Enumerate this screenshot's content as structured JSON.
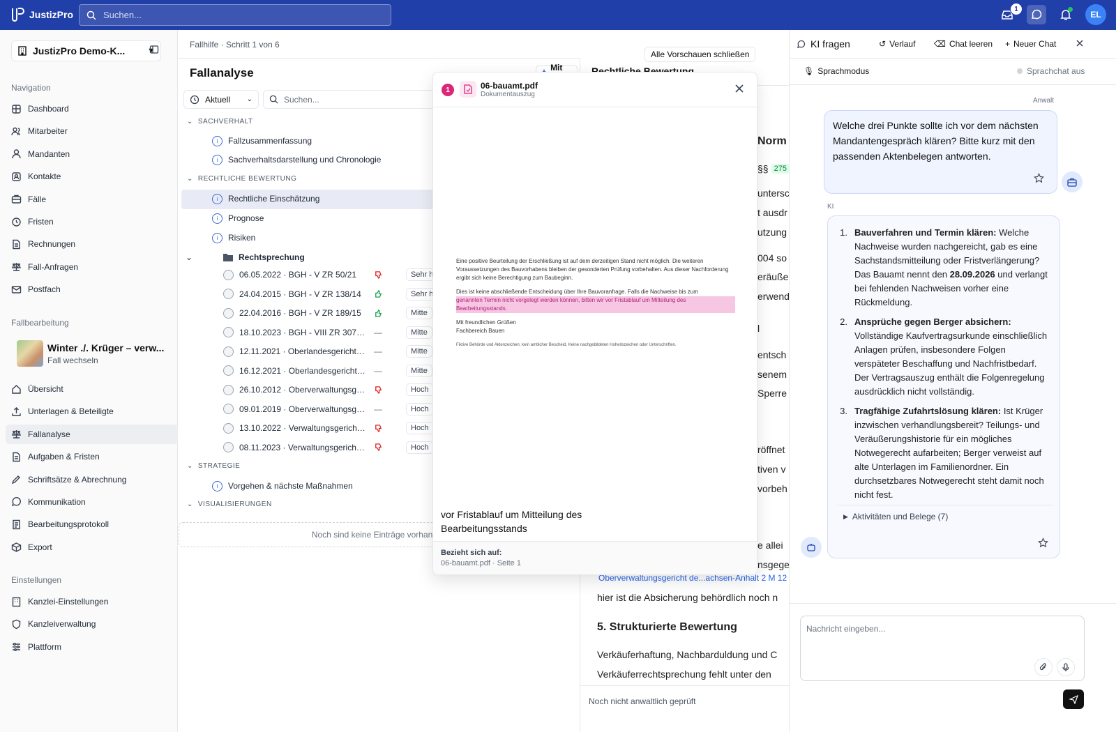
{
  "topbar": {
    "brand": "JustizPro",
    "search_placeholder": "Suchen...",
    "badge_count": "1",
    "avatar_initials": "EL"
  },
  "sidebar": {
    "org_name": "JustizPro Demo-K...",
    "nav_heading": "Navigation",
    "nav": [
      "Dashboard",
      "Mitarbeiter",
      "Mandanten",
      "Kontakte",
      "Fälle",
      "Fristen",
      "Rechnungen",
      "Fall-Anfragen",
      "Postfach"
    ],
    "case_heading": "Fallbearbeitung",
    "case_title": "Winter ./. Krüger – verw...",
    "case_switch": "Fall wechseln",
    "case_nav": [
      "Übersicht",
      "Unterlagen & Beteiligte",
      "Fallanalyse",
      "Aufgaben & Fristen",
      "Schriftsätze & Abrechnung",
      "Kommunikation",
      "Bearbeitungsprotokoll",
      "Export"
    ],
    "settings_heading": "Einstellungen",
    "settings": [
      "Kanzlei-Einstellungen",
      "Kanzleiverwaltung",
      "Plattform"
    ]
  },
  "main": {
    "breadcrumb": "Fallhilfe · Schritt 1 von 6",
    "title": "Fallanalyse",
    "ai_button": "Mit KI",
    "filter_label": "Aktuell",
    "search_placeholder": "Suchen...",
    "sections": {
      "sachverhalt": "SACHVERHALT",
      "rechtlich": "RECHTLICHE BEWERTUNG",
      "strategie": "STRATEGIE",
      "visual": "VISUALISIERUNGEN"
    },
    "sachverhalt_items": [
      "Fallzusammenfassung",
      "Sachverhaltsdarstellung und Chronologie"
    ],
    "rechtlich_items": [
      "Rechtliche Einschätzung",
      "Prognose",
      "Risiken"
    ],
    "folder": "Rechtsprechung",
    "cases": [
      {
        "label": "06.05.2022 · BGH - V ZR 50/21",
        "vote": "down",
        "tag": "Sehr hoch"
      },
      {
        "label": "24.04.2015 · BGH - V ZR 138/14",
        "vote": "up",
        "tag": "Sehr hoch"
      },
      {
        "label": "22.04.2016 · BGH - V ZR 189/15",
        "vote": "up",
        "tag": "Mitte"
      },
      {
        "label": "18.10.2023 · BGH - VIII ZR 307/20",
        "vote": "none",
        "tag": "Mitte"
      },
      {
        "label": "12.11.2021 · Oberlandesgericht Ka...",
        "vote": "none",
        "tag": "Mitte"
      },
      {
        "label": "16.12.2021 · Oberlandesgericht K...",
        "vote": "none",
        "tag": "Mitte"
      },
      {
        "label": "26.10.2012 · Oberverwaltungsger...",
        "vote": "down",
        "tag": "Hoch"
      },
      {
        "label": "09.01.2019 · Oberverwaltungsger...",
        "vote": "none",
        "tag": "Hoch"
      },
      {
        "label": "13.10.2022 · Verwaltungsgericht ...",
        "vote": "down",
        "tag": "Hoch"
      },
      {
        "label": "08.11.2023 · Verwaltungsgericht ...",
        "vote": "down",
        "tag": "Hoch"
      }
    ],
    "strategie_item": "Vorgehen & nächste Maßnahmen",
    "empty_visual": "Noch sind keine Einträge vorhand"
  },
  "right": {
    "header": "Rechtliche Bewertung",
    "norm_heading": "Norm",
    "para_chip": "275",
    "lines": [
      "§§",
      "untersc",
      "t ausdr",
      "utzung",
      "004 so",
      "eräußer",
      "erwend",
      "l",
      "entsch",
      "senem",
      "Sperre",
      "röffnet",
      "tiven v",
      "vorbeh",
      "e allei",
      "nsgege"
    ],
    "link": "Oberverwaltungsgericht de...achsen-Anhalt 2 M 12",
    "line_after_link": "hier ist die Absicherung behördlich noch n",
    "heading5": "5. Strukturierte Bewertung",
    "p1": "Verkäuferhaftung, Nachbarduldung und C",
    "p2": "Verkäuferrechtsprechung fehlt unter den",
    "footer": "Noch nicht anwaltlich geprüft"
  },
  "preview": {
    "close_all": "Alle Vorschauen schließen",
    "index": "1",
    "filename": "06-bauamt.pdf",
    "subtitle": "Dokumentauszug",
    "doc_p1": "Eine positive Beurteilung der Erschließung ist auf dem derzeitigen Stand nicht möglich. Die weiteren Voraussetzungen des Bauvorhabens bleiben der gesonderten Prüfung vorbehalten. Aus dieser Nachforderung ergibt sich keine Berechtigung zum Baubeginn.",
    "doc_p2_a": "Dies ist keine abschließende Entscheidung über Ihre Bauvoranfrage. Falls die Nachweise bis zum",
    "doc_p2_hl": "genannten Termin nicht vorgelegt werden können, bitten wir vor Fristablauf um Mitteilung des Bearbeitungsstands.",
    "doc_greet": "Mit freundlichen Grüßen",
    "doc_dept": "Fachbereich Bauen",
    "doc_fine": "Fiktive Behörde und Aktenzeichen; kein amtlicher Bescheid. Keine nachgebildeten Hoheitszeichen oder Unterschriften.",
    "quote": "vor Fristablauf um Mitteilung des Bearbeitungsstands",
    "ref_label": "Bezieht sich auf:",
    "ref_value": "06-bauamt.pdf · Seite 1"
  },
  "chat": {
    "title": "KI fragen",
    "history": "Verlauf",
    "clear": "Chat leeren",
    "new": "Neuer Chat",
    "voice_mode": "Sprachmodus",
    "voice_status": "Sprachchat aus",
    "user_role": "Anwalt",
    "user_msg": "Welche drei Punkte sollte ich vor dem nächsten Mandantengespräch klären? Bitte kurz mit den passenden Aktenbelegen antworten.",
    "ai_role": "KI",
    "ai_items": [
      {
        "n": "1.",
        "bold": "Bauverfahren und Termin klären:",
        "pre": " Welche Nachweise wurden nachgereicht, gab es eine Sachstandsmitteilung oder Fristverlängerung? Das Bauamt nennt den ",
        "date": "28.09.2026",
        "post": " und verlangt bei fehlenden Nachweisen vorher eine Rückmeldung."
      },
      {
        "n": "2.",
        "bold": "Ansprüche gegen Berger absichern:",
        "pre": " Vollständige Kaufvertragsurkunde einschließlich Anlagen prüfen, insbesondere Folgen verspäteter Beschaffung und Nachfristbedarf. Der Vertragsauszug enthält die Folgenregelung ausdrücklich nicht vollständig.",
        "date": "",
        "post": ""
      },
      {
        "n": "3.",
        "bold": "Tragfähige Zufahrtslösung klären:",
        "pre": " Ist Krüger inzwischen verhandlungsbereit? Teilungs- und Veräußerungshistorie für ein mögliches Notwegerecht aufarbeiten; Berger verweist auf alte Unterlagen im Familienordner. Ein durchsetzbares Notwegerecht steht damit noch nicht fest.",
        "date": "",
        "post": ""
      }
    ],
    "activities": "Aktivitäten und Belege (7)",
    "input_placeholder": "Nachricht eingeben..."
  }
}
